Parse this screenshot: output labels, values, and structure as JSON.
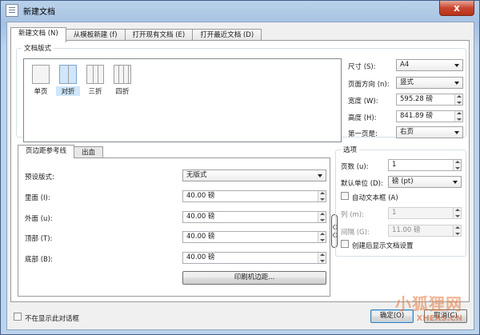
{
  "window": {
    "title": "新建文档",
    "close": "x"
  },
  "tabs": [
    {
      "label": "新建文档 (N)"
    },
    {
      "label": "从模板新建 (f)"
    },
    {
      "label": "打开现有文档 (E)"
    },
    {
      "label": "打开最近文档 (D)"
    }
  ],
  "layout": {
    "group_title": "文档版式",
    "items": [
      {
        "label": "单页"
      },
      {
        "label": "对折"
      },
      {
        "label": "三折"
      },
      {
        "label": "四折"
      }
    ],
    "selected": "对折"
  },
  "page_props": {
    "size_label": "尺寸 (S):",
    "size_value": "A4",
    "orientation_label": "页面方向 (n):",
    "orientation_value": "竖式",
    "width_label": "宽度 (W):",
    "width_value": "595.28 磅",
    "height_label": "高度 (H):",
    "height_value": "841.89 磅",
    "first_page_label": "第一页是:",
    "first_page_value": "右页"
  },
  "margin_tabs": [
    {
      "label": "页边距参考线"
    },
    {
      "label": "出血"
    }
  ],
  "margins": {
    "preset_label": "预设版式:",
    "preset_value": "无版式",
    "inside_label": "里面 (I):",
    "inside_value": "40.00 磅",
    "outside_label": "外面 (u):",
    "outside_value": "40.00 磅",
    "top_label": "顶部 (T):",
    "top_value": "40.00 磅",
    "bottom_label": "底部 (B):",
    "bottom_value": "40.00 磅",
    "printer_button": "印刷机边距..."
  },
  "options": {
    "group_title": "选项",
    "pages_label": "页数 (u):",
    "pages_value": "1",
    "unit_label": "默认单位 (D):",
    "unit_value": "磅 (pt)",
    "auto_frame_label": "自动文本框 (A)",
    "columns_label": "列 (m):",
    "columns_value": "1",
    "gap_label": "间隔 (G):",
    "gap_value": "11.00 磅",
    "show_settings_label": "创建后显示文档设置"
  },
  "footer": {
    "dont_show_label": "不在显示此对话框",
    "ok_button": "确定(O)",
    "cancel_button": "取消(C)"
  },
  "watermark": {
    "brand": "小狐狸网",
    "url": "XHERS.CN"
  }
}
